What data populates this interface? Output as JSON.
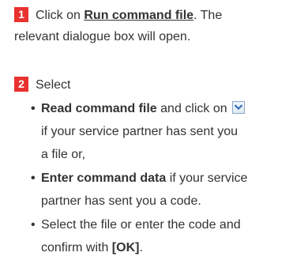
{
  "step1": {
    "number": "1",
    "prefix": "Click on ",
    "link": "Run command file",
    "suffix": ". The",
    "line2": "relevant dialogue box will open."
  },
  "step2": {
    "number": "2",
    "heading": "Select",
    "bullets": [
      {
        "bullet": "•",
        "bold": "Read command file",
        "text_a": " and click on ",
        "icon": "chevron-down-icon",
        "text_b": "if your service partner has sent you",
        "text_c": "a file or,"
      },
      {
        "bullet": "•",
        "bold": "Enter command data",
        "text_a": " if your service",
        "text_b": "partner has sent you a code."
      },
      {
        "bullet": "•",
        "text_a": "Select the file or enter the code and",
        "text_b": "confirm with ",
        "bold": "[OK]",
        "text_c": "."
      }
    ]
  },
  "colors": {
    "step_badge": "#e8322e",
    "text": "#333333",
    "icon_border": "#8aa8c8",
    "icon_chevron": "#2f6fb6"
  }
}
